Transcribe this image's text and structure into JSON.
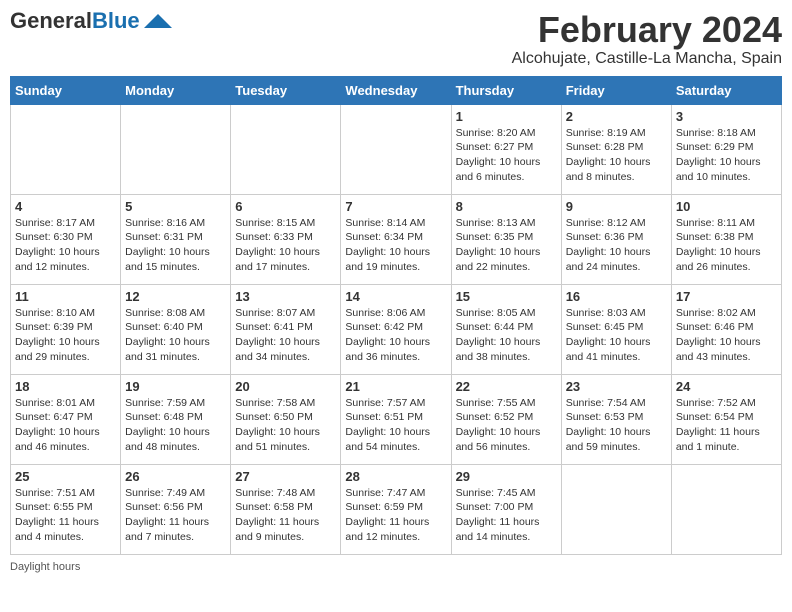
{
  "header": {
    "logo_general": "General",
    "logo_blue": "Blue",
    "title": "February 2024",
    "location": "Alcohujate, Castille-La Mancha, Spain"
  },
  "days_of_week": [
    "Sunday",
    "Monday",
    "Tuesday",
    "Wednesday",
    "Thursday",
    "Friday",
    "Saturday"
  ],
  "weeks": [
    [
      {
        "day": "",
        "info": ""
      },
      {
        "day": "",
        "info": ""
      },
      {
        "day": "",
        "info": ""
      },
      {
        "day": "",
        "info": ""
      },
      {
        "day": "1",
        "info": "Sunrise: 8:20 AM\nSunset: 6:27 PM\nDaylight: 10 hours and 6 minutes."
      },
      {
        "day": "2",
        "info": "Sunrise: 8:19 AM\nSunset: 6:28 PM\nDaylight: 10 hours and 8 minutes."
      },
      {
        "day": "3",
        "info": "Sunrise: 8:18 AM\nSunset: 6:29 PM\nDaylight: 10 hours and 10 minutes."
      }
    ],
    [
      {
        "day": "4",
        "info": "Sunrise: 8:17 AM\nSunset: 6:30 PM\nDaylight: 10 hours and 12 minutes."
      },
      {
        "day": "5",
        "info": "Sunrise: 8:16 AM\nSunset: 6:31 PM\nDaylight: 10 hours and 15 minutes."
      },
      {
        "day": "6",
        "info": "Sunrise: 8:15 AM\nSunset: 6:33 PM\nDaylight: 10 hours and 17 minutes."
      },
      {
        "day": "7",
        "info": "Sunrise: 8:14 AM\nSunset: 6:34 PM\nDaylight: 10 hours and 19 minutes."
      },
      {
        "day": "8",
        "info": "Sunrise: 8:13 AM\nSunset: 6:35 PM\nDaylight: 10 hours and 22 minutes."
      },
      {
        "day": "9",
        "info": "Sunrise: 8:12 AM\nSunset: 6:36 PM\nDaylight: 10 hours and 24 minutes."
      },
      {
        "day": "10",
        "info": "Sunrise: 8:11 AM\nSunset: 6:38 PM\nDaylight: 10 hours and 26 minutes."
      }
    ],
    [
      {
        "day": "11",
        "info": "Sunrise: 8:10 AM\nSunset: 6:39 PM\nDaylight: 10 hours and 29 minutes."
      },
      {
        "day": "12",
        "info": "Sunrise: 8:08 AM\nSunset: 6:40 PM\nDaylight: 10 hours and 31 minutes."
      },
      {
        "day": "13",
        "info": "Sunrise: 8:07 AM\nSunset: 6:41 PM\nDaylight: 10 hours and 34 minutes."
      },
      {
        "day": "14",
        "info": "Sunrise: 8:06 AM\nSunset: 6:42 PM\nDaylight: 10 hours and 36 minutes."
      },
      {
        "day": "15",
        "info": "Sunrise: 8:05 AM\nSunset: 6:44 PM\nDaylight: 10 hours and 38 minutes."
      },
      {
        "day": "16",
        "info": "Sunrise: 8:03 AM\nSunset: 6:45 PM\nDaylight: 10 hours and 41 minutes."
      },
      {
        "day": "17",
        "info": "Sunrise: 8:02 AM\nSunset: 6:46 PM\nDaylight: 10 hours and 43 minutes."
      }
    ],
    [
      {
        "day": "18",
        "info": "Sunrise: 8:01 AM\nSunset: 6:47 PM\nDaylight: 10 hours and 46 minutes."
      },
      {
        "day": "19",
        "info": "Sunrise: 7:59 AM\nSunset: 6:48 PM\nDaylight: 10 hours and 48 minutes."
      },
      {
        "day": "20",
        "info": "Sunrise: 7:58 AM\nSunset: 6:50 PM\nDaylight: 10 hours and 51 minutes."
      },
      {
        "day": "21",
        "info": "Sunrise: 7:57 AM\nSunset: 6:51 PM\nDaylight: 10 hours and 54 minutes."
      },
      {
        "day": "22",
        "info": "Sunrise: 7:55 AM\nSunset: 6:52 PM\nDaylight: 10 hours and 56 minutes."
      },
      {
        "day": "23",
        "info": "Sunrise: 7:54 AM\nSunset: 6:53 PM\nDaylight: 10 hours and 59 minutes."
      },
      {
        "day": "24",
        "info": "Sunrise: 7:52 AM\nSunset: 6:54 PM\nDaylight: 11 hours and 1 minute."
      }
    ],
    [
      {
        "day": "25",
        "info": "Sunrise: 7:51 AM\nSunset: 6:55 PM\nDaylight: 11 hours and 4 minutes."
      },
      {
        "day": "26",
        "info": "Sunrise: 7:49 AM\nSunset: 6:56 PM\nDaylight: 11 hours and 7 minutes."
      },
      {
        "day": "27",
        "info": "Sunrise: 7:48 AM\nSunset: 6:58 PM\nDaylight: 11 hours and 9 minutes."
      },
      {
        "day": "28",
        "info": "Sunrise: 7:47 AM\nSunset: 6:59 PM\nDaylight: 11 hours and 12 minutes."
      },
      {
        "day": "29",
        "info": "Sunrise: 7:45 AM\nSunset: 7:00 PM\nDaylight: 11 hours and 14 minutes."
      },
      {
        "day": "",
        "info": ""
      },
      {
        "day": "",
        "info": ""
      }
    ]
  ],
  "footer": {
    "daylight_label": "Daylight hours"
  }
}
